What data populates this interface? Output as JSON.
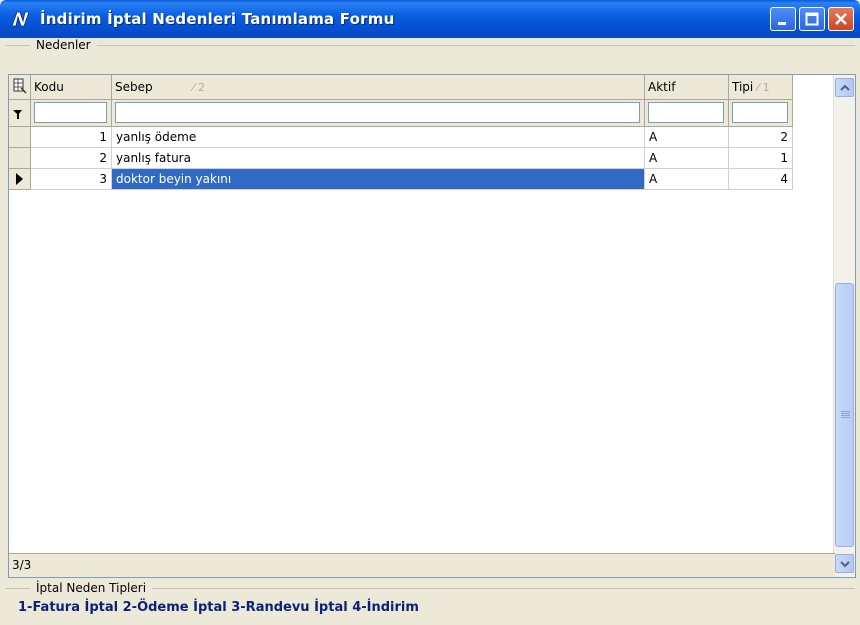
{
  "window": {
    "title": "İndirim İptal Nedenleri Tanımlama Formu"
  },
  "group_nedenler": {
    "label": "Nedenler"
  },
  "grid": {
    "columns": [
      {
        "key": "kodu",
        "label": "Kodu",
        "sort": ""
      },
      {
        "key": "sebep",
        "label": "Sebep",
        "sort": "⁄ 2"
      },
      {
        "key": "aktif",
        "label": "Aktif",
        "sort": ""
      },
      {
        "key": "tipi",
        "label": "Tipi",
        "sort": "⁄ 1"
      }
    ],
    "rows": [
      {
        "kodu": "1",
        "sebep": "yanlış ödeme",
        "aktif": "A",
        "tipi": "2"
      },
      {
        "kodu": "2",
        "sebep": "yanlış fatura",
        "aktif": "A",
        "tipi": "1"
      },
      {
        "kodu": "3",
        "sebep": "doktor beyin yakını",
        "aktif": "A",
        "tipi": "4"
      }
    ],
    "selected_row": 3,
    "record_counter": "3/3"
  },
  "group_tipler": {
    "label": "İptal Neden Tipleri",
    "text": "1-Fatura İptal 2-Ödeme İptal 3-Randevu İptal 4-İndirim"
  },
  "colors": {
    "selection": "#316ac5",
    "titlebar": "#0a5fe0",
    "types_text": "#0c1f7a"
  }
}
